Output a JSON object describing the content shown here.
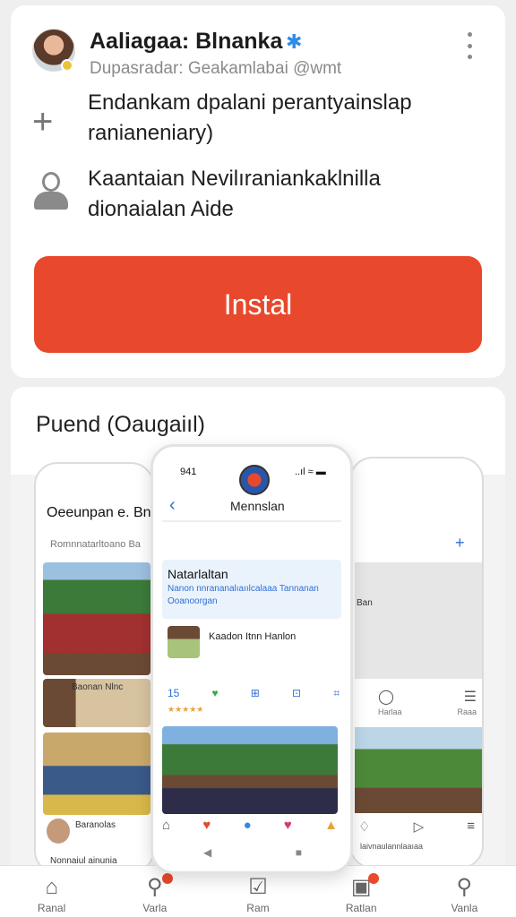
{
  "developer": {
    "name": "Aaliagaa: Blnanka",
    "subtitle": "Dupasradar: Geakamlabai @wmt"
  },
  "features": [
    {
      "icon": "plus-icon",
      "text": "Endankam dpalani perantyainslap ranianeniary)"
    },
    {
      "icon": "person-icon",
      "text": "Kaantaian Nevilıraniankaklnilla dionaialan Aide"
    }
  ],
  "install": {
    "label": "Instal"
  },
  "section": {
    "title": "Puend (Oaugaiıl)"
  },
  "screenshots": {
    "left": {
      "title": "Oeeunpan e. Bni",
      "subtitle": "Romnnatarltoano  Ba",
      "caption1": "Baonan Nlnc",
      "caption2": "Baranolas",
      "caption3": "Nonnaiul ainunia"
    },
    "center": {
      "time": "941",
      "status": "..ıl ≈ ▬",
      "header": "Mennslan",
      "highlight_title": "Natarlaltan",
      "highlight_sub": "Nanon nnrananalıaıılcalaaa  Tannanan Ooanoorgan",
      "item_text": "Kaadon Itnn Hanlon",
      "stats": [
        "15",
        "♥",
        "⊞",
        "⊡",
        "⌗"
      ],
      "stars": "★★★★★"
    },
    "right": {
      "label": "Ban",
      "captions": [
        "Harlaa",
        "Raaa"
      ],
      "bottom_caption": "laivnaulannlaaıaa"
    }
  },
  "bottom_nav": [
    {
      "label": "Ranal",
      "icon": "home-icon"
    },
    {
      "label": "Varla",
      "icon": "search-badge-icon"
    },
    {
      "label": "Ram",
      "icon": "inbox-icon"
    },
    {
      "label": "Ratlan",
      "icon": "image-icon"
    },
    {
      "label": "Vanla",
      "icon": "search-icon"
    }
  ],
  "colors": {
    "accent": "#e8482c",
    "link": "#2f6fd6",
    "verified": "#2f8be8"
  }
}
